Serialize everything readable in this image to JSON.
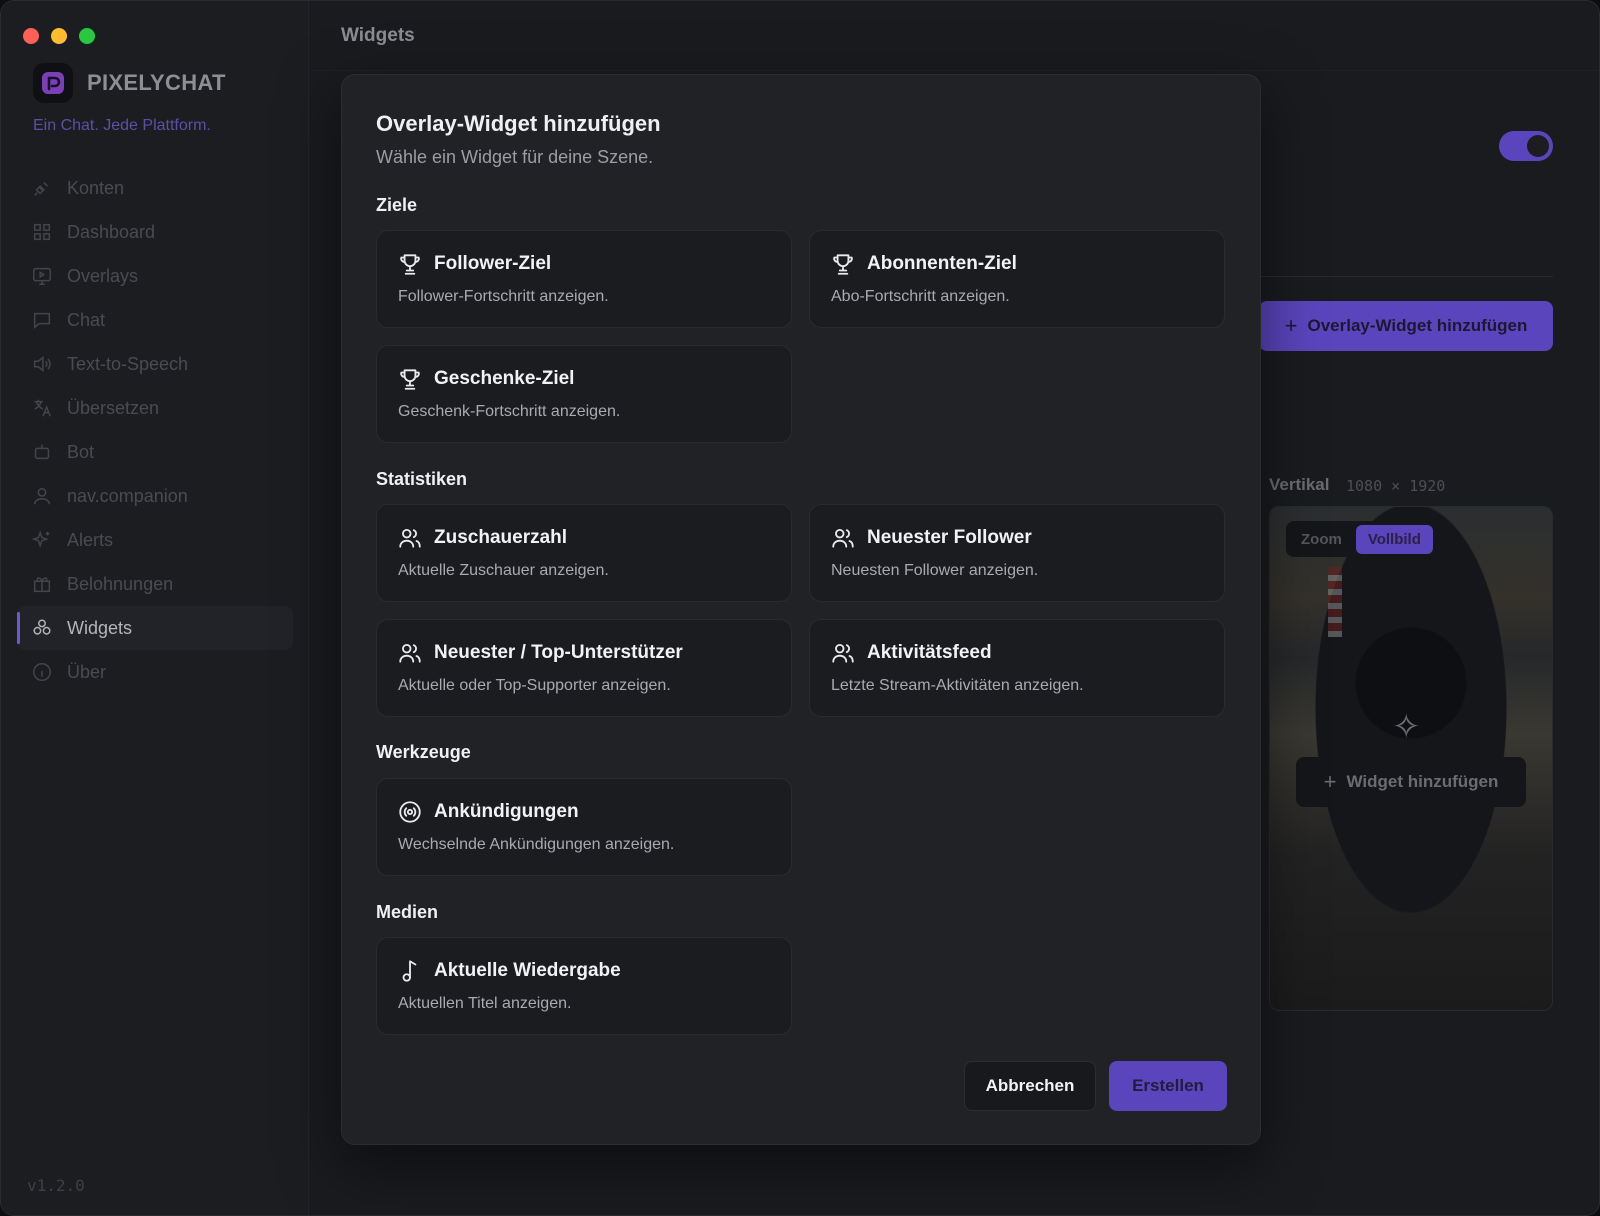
{
  "app": {
    "brand_name": "PIXELYCHAT",
    "tagline": "Ein Chat. Jede Plattform.",
    "version": "v1.2.0",
    "page_title": "Widgets",
    "accent_color": "#5b45bd"
  },
  "sidebar": {
    "items": [
      {
        "label": "Konten",
        "icon": "plug-icon"
      },
      {
        "label": "Dashboard",
        "icon": "grid-icon"
      },
      {
        "label": "Overlays",
        "icon": "monitor-icon"
      },
      {
        "label": "Chat",
        "icon": "chat-icon"
      },
      {
        "label": "Text-to-Speech",
        "icon": "speaker-icon"
      },
      {
        "label": "Übersetzen",
        "icon": "translate-icon"
      },
      {
        "label": "Bot",
        "icon": "bot-icon"
      },
      {
        "label": "nav.companion",
        "icon": "user-icon"
      },
      {
        "label": "Alerts",
        "icon": "sparkle-icon"
      },
      {
        "label": "Belohnungen",
        "icon": "gift-icon"
      },
      {
        "label": "Widgets",
        "icon": "widgets-icon",
        "active": true
      },
      {
        "label": "Über",
        "icon": "info-icon"
      }
    ]
  },
  "background": {
    "add_overlay_widget_label": "Overlay-Widget hinzufügen",
    "vertical_label": "Vertikal",
    "vertical_size": "1080 × 1920",
    "zoom_label": "Zoom",
    "fullscreen_label": "Vollbild",
    "add_widget_label": "Widget hinzufügen",
    "toggle_on": true
  },
  "modal": {
    "title": "Overlay-Widget hinzufügen",
    "subtitle": "Wähle ein Widget für deine Szene.",
    "sections": {
      "goals": "Ziele",
      "stats": "Statistiken",
      "tools": "Werkzeuge",
      "media": "Medien"
    },
    "cards": {
      "follower_goal": {
        "title": "Follower-Ziel",
        "desc": "Follower-Fortschritt anzeigen.",
        "icon": "trophy-icon"
      },
      "subscriber_goal": {
        "title": "Abonnenten-Ziel",
        "desc": "Abo-Fortschritt anzeigen.",
        "icon": "trophy-icon"
      },
      "gift_goal": {
        "title": "Geschenke-Ziel",
        "desc": "Geschenk-Fortschritt anzeigen.",
        "icon": "trophy-icon"
      },
      "viewer_count": {
        "title": "Zuschauerzahl",
        "desc": "Aktuelle Zuschauer anzeigen.",
        "icon": "users-icon"
      },
      "latest_follower": {
        "title": "Neuester Follower",
        "desc": "Neuesten Follower anzeigen.",
        "icon": "users-icon"
      },
      "top_supporter": {
        "title": "Neuester / Top-Unterstützer",
        "desc": "Aktuelle oder Top-Supporter anzeigen.",
        "icon": "users-icon"
      },
      "activity_feed": {
        "title": "Aktivitätsfeed",
        "desc": "Letzte Stream-Aktivitäten anzeigen.",
        "icon": "users-icon"
      },
      "announcements": {
        "title": "Ankündigungen",
        "desc": "Wechselnde Ankündigungen anzeigen.",
        "icon": "broadcast-icon"
      },
      "now_playing": {
        "title": "Aktuelle Wiedergabe",
        "desc": "Aktuellen Titel anzeigen.",
        "icon": "music-note-icon"
      }
    },
    "cancel_label": "Abbrechen",
    "create_label": "Erstellen"
  }
}
